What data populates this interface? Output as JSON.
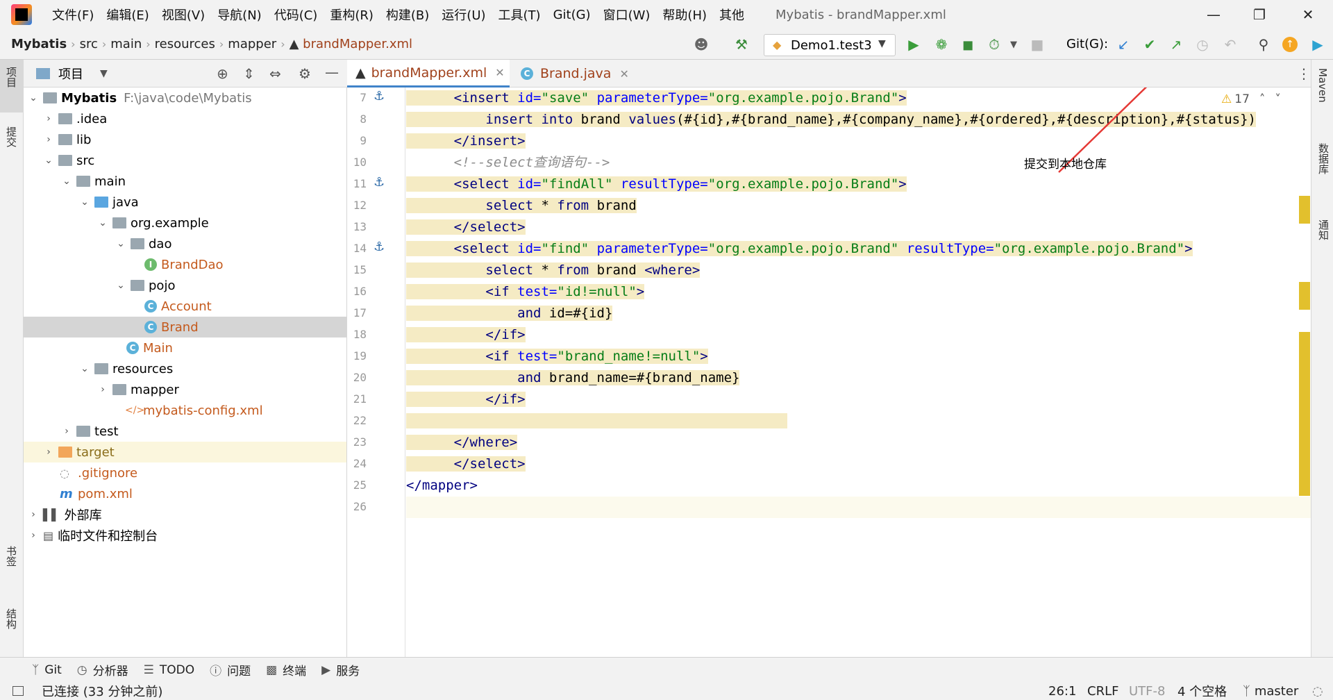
{
  "menu": {
    "items": [
      "文件(F)",
      "编辑(E)",
      "视图(V)",
      "导航(N)",
      "代码(C)",
      "重构(R)",
      "构建(B)",
      "运行(U)",
      "工具(T)",
      "Git(G)",
      "窗口(W)",
      "帮助(H)",
      "其他"
    ],
    "window_title": "Mybatis - brandMapper.xml"
  },
  "breadcrumb": [
    "Mybatis",
    "src",
    "main",
    "resources",
    "mapper",
    "brandMapper.xml"
  ],
  "toolbar": {
    "run_config": "Demo1.test3",
    "git_label": "Git(G):"
  },
  "left_strip": {
    "project": "项目",
    "commit": "提交",
    "bookmarks": "书签",
    "structure": "结构"
  },
  "right_strip": {
    "maven": "Maven",
    "database": "数据库",
    "notifications": "通知"
  },
  "project_panel": {
    "title": "项目",
    "root_name": "Mybatis",
    "root_path": "F:\\java\\code\\Mybatis",
    "nodes": [
      ".idea",
      "lib",
      "src",
      "main",
      "java",
      "org.example",
      "dao",
      "BrandDao",
      "pojo",
      "Account",
      "Brand",
      "Main",
      "resources",
      "mapper",
      "mybatis-config.xml",
      "test",
      "target",
      ".gitignore",
      "pom.xml",
      "外部库",
      "临时文件和控制台"
    ]
  },
  "editor": {
    "tabs": [
      "brandMapper.xml",
      "Brand.java"
    ],
    "warning_count": "17",
    "line_numbers": [
      "7",
      "8",
      "9",
      "10",
      "11",
      "12",
      "13",
      "14",
      "15",
      "16",
      "17",
      "18",
      "19",
      "20",
      "21",
      "22",
      "23",
      "24",
      "25",
      "26"
    ]
  },
  "annotation": {
    "text": "提交到本地仓库",
    "color": "#e53935"
  },
  "bottom_tabs": [
    "Git",
    "分析器",
    "TODO",
    "问题",
    "终端",
    "服务"
  ],
  "status": {
    "connection": "已连接 (33 分钟之前)",
    "position": "26:1",
    "line_sep": "CRLF",
    "encoding": "UTF-8",
    "indent": "4 个空格",
    "branch": "master"
  },
  "colors": {
    "highlight": "#f5ebc4",
    "tag": "#000080",
    "attr": "#0000ff",
    "value": "#067d17"
  }
}
